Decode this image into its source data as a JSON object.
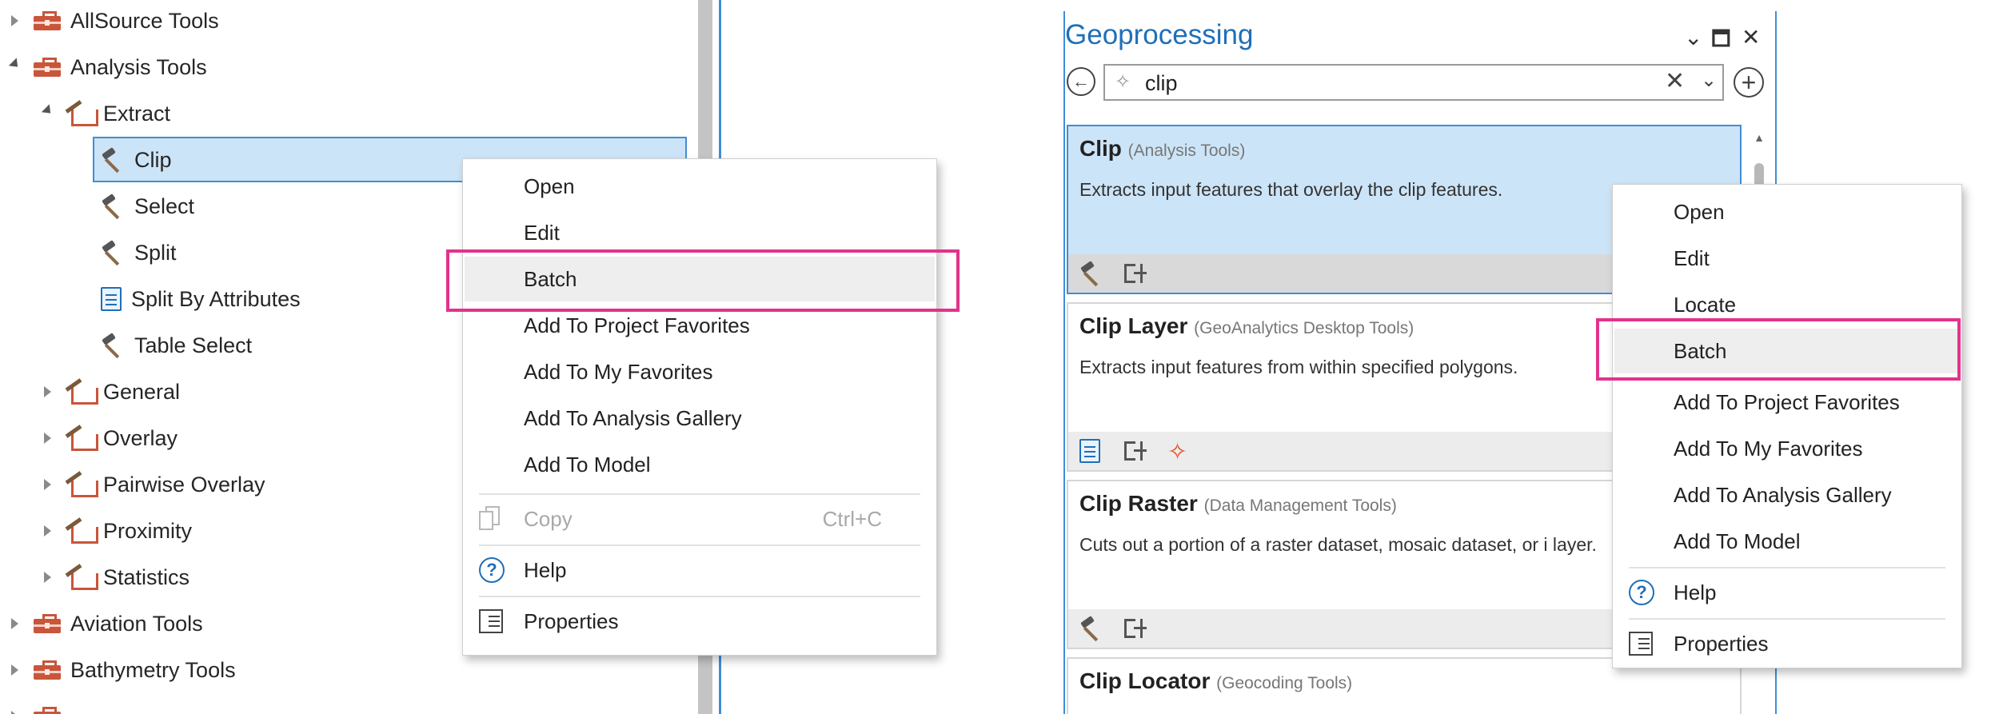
{
  "catalog_tree": {
    "items": [
      {
        "label": "AllSource Tools",
        "type": "toolbox",
        "expanded": false
      },
      {
        "label": "Analysis Tools",
        "type": "toolbox",
        "expanded": true
      },
      {
        "label": "Extract",
        "type": "toolset",
        "expanded": true
      },
      {
        "label": "Clip",
        "type": "tool",
        "selected": true
      },
      {
        "label": "Select",
        "type": "tool"
      },
      {
        "label": "Split",
        "type": "tool"
      },
      {
        "label": "Split By Attributes",
        "type": "script-tool"
      },
      {
        "label": "Table Select",
        "type": "tool"
      },
      {
        "label": "General",
        "type": "toolset",
        "expanded": false
      },
      {
        "label": "Overlay",
        "type": "toolset",
        "expanded": false
      },
      {
        "label": "Pairwise Overlay",
        "type": "toolset",
        "expanded": false
      },
      {
        "label": "Proximity",
        "type": "toolset",
        "expanded": false
      },
      {
        "label": "Statistics",
        "type": "toolset",
        "expanded": false
      },
      {
        "label": "Aviation Tools",
        "type": "toolbox",
        "expanded": false
      },
      {
        "label": "Bathymetry Tools",
        "type": "toolbox",
        "expanded": false
      }
    ]
  },
  "tree_context_menu": {
    "items": [
      {
        "label": "Open"
      },
      {
        "label": "Edit"
      },
      {
        "label": "Batch",
        "highlighted": true
      },
      {
        "label": "Add To Project Favorites"
      },
      {
        "label": "Add To My Favorites"
      },
      {
        "label": "Add To Analysis Gallery"
      },
      {
        "label": "Add To Model"
      },
      {
        "label": "Copy",
        "shortcut": "Ctrl+C",
        "disabled": true,
        "icon": "copy-icon"
      },
      {
        "label": "Help",
        "icon": "help-icon"
      },
      {
        "label": "Properties",
        "icon": "properties-icon"
      }
    ]
  },
  "geoprocessing": {
    "title": "Geoprocessing",
    "window_controls": {
      "menu": "⌄",
      "maximize": "🗖",
      "close": "✕"
    },
    "search": {
      "value": "clip",
      "clear": "✕",
      "dropdown": "⌄"
    },
    "back_glyph": "←",
    "add_glyph": "+",
    "results": [
      {
        "name": "Clip",
        "toolbox": "(Analysis Tools)",
        "description": "Extracts input features that overlay the clip features.",
        "selected": true
      },
      {
        "name": "Clip Layer",
        "toolbox": "(GeoAnalytics Desktop Tools)",
        "description": "Extracts input features from within specified polygons."
      },
      {
        "name": "Clip Raster",
        "toolbox": "(Data Management Tools)",
        "description": "Cuts out a portion of a raster dataset, mosaic dataset, or i layer."
      },
      {
        "name": "Clip Locator",
        "toolbox": "(Geocoding Tools)",
        "description": ""
      }
    ]
  },
  "geo_context_menu": {
    "items": [
      {
        "label": "Open"
      },
      {
        "label": "Edit"
      },
      {
        "label": "Locate"
      },
      {
        "label": "Batch",
        "highlighted": true
      },
      {
        "label": "Add To Project Favorites"
      },
      {
        "label": "Add To My Favorites"
      },
      {
        "label": "Add To Analysis Gallery"
      },
      {
        "label": "Add To Model"
      },
      {
        "label": "Help",
        "icon": "help-icon"
      },
      {
        "label": "Properties",
        "icon": "properties-icon"
      }
    ]
  },
  "colors": {
    "highlight_outline": "#e2338b",
    "selection_fill": "#cce4f7",
    "selection_border": "#3f8ed6",
    "toolbox_red": "#c9553a",
    "title_blue": "#1f6fb8"
  }
}
